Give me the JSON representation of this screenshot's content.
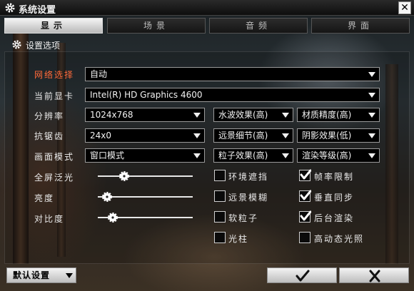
{
  "window": {
    "title": "系统设置",
    "close_label": "✕"
  },
  "tabs": [
    {
      "label": "显示",
      "active": true
    },
    {
      "label": "场景",
      "active": false
    },
    {
      "label": "音频",
      "active": false
    },
    {
      "label": "界面",
      "active": false
    }
  ],
  "section": {
    "title": "设置选项"
  },
  "settings": {
    "network": {
      "label": "网络选择",
      "value": "自动"
    },
    "gpu": {
      "label": "当前显卡",
      "value": "Intel(R) HD Graphics 4600"
    },
    "resolution": {
      "label": "分辨率",
      "value": "1024x768"
    },
    "antialias": {
      "label": "抗锯齿",
      "value": "24x0"
    },
    "display_mode": {
      "label": "画面模式",
      "value": "窗口模式"
    },
    "water": {
      "value": "水波效果(高)"
    },
    "material": {
      "value": "材质精度(高)"
    },
    "distance_detail": {
      "value": "远景细节(高)"
    },
    "shadow": {
      "value": "阴影效果(低)"
    },
    "particles": {
      "value": "粒子效果(高)"
    },
    "render_level": {
      "value": "渲染等级(高)"
    }
  },
  "sliders": [
    {
      "label": "全屏泛光",
      "value": 0.28
    },
    {
      "label": "亮度",
      "value": 0.1
    },
    {
      "label": "对比度",
      "value": 0.16
    }
  ],
  "checkboxes": [
    {
      "label": "环境遮挡",
      "checked": false
    },
    {
      "label": "帧率限制",
      "checked": true
    },
    {
      "label": "远景模糊",
      "checked": false
    },
    {
      "label": "垂直同步",
      "checked": true
    },
    {
      "label": "软粒子",
      "checked": false
    },
    {
      "label": "后台渲染",
      "checked": true
    },
    {
      "label": "光柱",
      "checked": false
    },
    {
      "label": "高动态光照",
      "checked": false
    }
  ],
  "footer": {
    "default_label": "默认设置",
    "confirm_icon": "check-icon",
    "cancel_icon": "cross-icon"
  },
  "colors": {
    "highlight_label": "#ff6a3a",
    "active_tab": "#e0e0e0"
  }
}
